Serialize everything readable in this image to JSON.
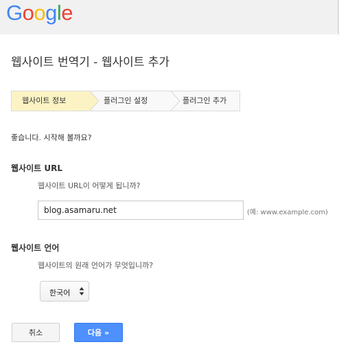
{
  "logo": {
    "text": "Google",
    "letters": [
      "G",
      "o",
      "o",
      "g",
      "l",
      "e"
    ],
    "colors": [
      "#4285f4",
      "#ea4335",
      "#fbbc05",
      "#4285f4",
      "#34a853",
      "#ea4335"
    ]
  },
  "page": {
    "title": "웹사이트 번역기 - 웹사이트 추가"
  },
  "steps": [
    {
      "label": "웹사이트 정보",
      "active": true
    },
    {
      "label": "플러그인 설정",
      "active": false
    },
    {
      "label": "플러그인 추가",
      "active": false
    }
  ],
  "intro": "좋습니다. 시작해 볼까요?",
  "website_url": {
    "label": "웹사이트 URL",
    "question": "웹사이트 URL이 어떻게 됩니까?",
    "value": "blog.asamaru.net",
    "example": "(예: www.example.com)"
  },
  "website_language": {
    "label": "웹사이트 언어",
    "question": "웹사이트의 원래 언어가 무엇입니까?",
    "selected": "한국어"
  },
  "buttons": {
    "cancel": "취소",
    "next": "다음 »"
  },
  "colors": {
    "active_step": "#fcf3c4",
    "primary_button": "#4d90fe"
  }
}
